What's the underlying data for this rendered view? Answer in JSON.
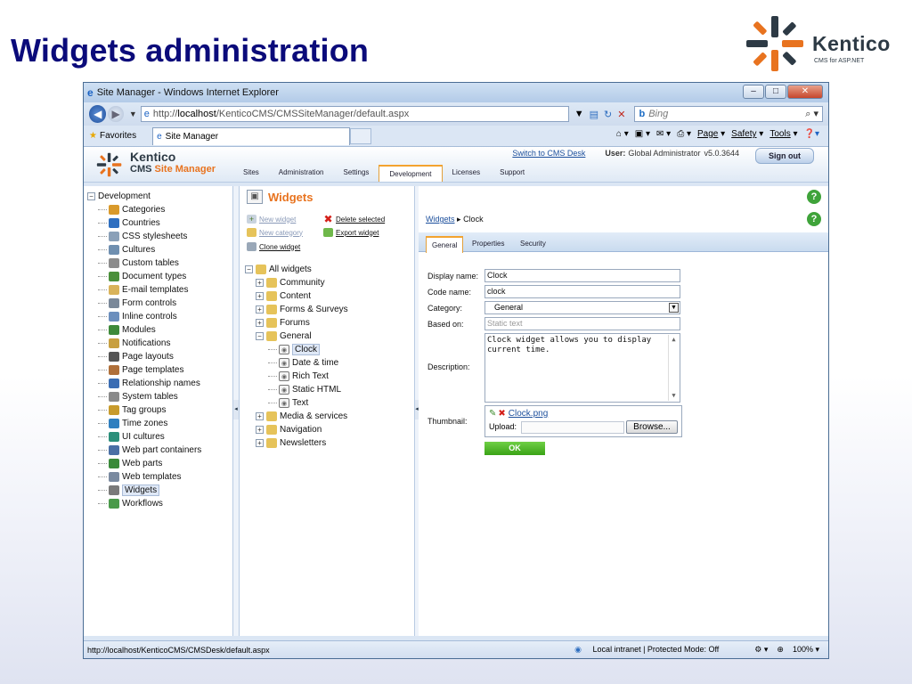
{
  "slide": {
    "title": "Widgets administration"
  },
  "brand": {
    "name": "Kentico",
    "subtitle": "CMS for ASP.NET"
  },
  "browser": {
    "window_title": "Site Manager - Windows Internet Explorer",
    "address_prefix": "http://",
    "address_host": "localhost",
    "address_path": "/KenticoCMS/CMSSiteManager/default.aspx",
    "search_placeholder": "Bing",
    "favorites_label": "Favorites",
    "tab_label": "Site Manager",
    "cmd_page": "Page",
    "cmd_safety": "Safety",
    "cmd_tools": "Tools",
    "status_url": "http://localhost/KenticoCMS/CMSDesk/default.aspx",
    "status_zone": "Local intranet | Protected Mode: Off",
    "zoom": "100%"
  },
  "cms": {
    "logo_name": "Kentico",
    "logo_sub_a": "CMS",
    "logo_sub_b": "Site Manager",
    "switch_link": "Switch to CMS Desk",
    "user_label": "User:",
    "user_name": "Global Administrator",
    "version": "v5.0.3644",
    "sign_out": "Sign out",
    "tabs": [
      "Sites",
      "Administration",
      "Settings",
      "Development",
      "Licenses",
      "Support"
    ]
  },
  "left_tree": {
    "root": "Development",
    "items": [
      "Categories",
      "Countries",
      "CSS stylesheets",
      "Cultures",
      "Custom tables",
      "Document types",
      "E-mail templates",
      "Form controls",
      "Inline controls",
      "Modules",
      "Notifications",
      "Page layouts",
      "Page templates",
      "Relationship names",
      "System tables",
      "Tag groups",
      "Time zones",
      "UI cultures",
      "Web part containers",
      "Web parts",
      "Web templates",
      "Widgets",
      "Workflows"
    ],
    "colors": [
      "#d99a2b",
      "#2f6fc0",
      "#8aa0b8",
      "#6f8fb0",
      "#8c8c8c",
      "#4a8f3a",
      "#d9b35a",
      "#7a8899",
      "#6c8fbd",
      "#3e8a3a",
      "#c8a040",
      "#555555",
      "#b0703a",
      "#3b6db3",
      "#8a8a8a",
      "#c89b2c",
      "#2f7fbf",
      "#2b8f7a",
      "#4a6fa5",
      "#3a8a3a",
      "#7a8aa0",
      "#7a7a7a",
      "#4a9a4a"
    ]
  },
  "widgets_panel": {
    "title": "Widgets",
    "new_widget": "New widget",
    "delete_selected": "Delete selected",
    "new_category": "New category",
    "export_widget": "Export widget",
    "clone_widget": "Clone widget",
    "tree_root": "All widgets",
    "categories": [
      "Community",
      "Content",
      "Forms & Surveys",
      "Forums",
      "General"
    ],
    "general_children": [
      "Clock",
      "Date & time",
      "Rich Text",
      "Static HTML",
      "Text"
    ],
    "categories_after": [
      "Media & services",
      "Navigation",
      "Newsletters"
    ]
  },
  "detail": {
    "breadcrumb_root": "Widgets",
    "breadcrumb_current": "Clock",
    "tabs": [
      "General",
      "Properties",
      "Security"
    ],
    "labels": {
      "display_name": "Display name:",
      "code_name": "Code name:",
      "category": "Category:",
      "based_on": "Based on:",
      "description": "Description:",
      "thumbnail": "Thumbnail:"
    },
    "display_name": "Clock",
    "code_name": "clock",
    "category": "General",
    "based_on": "Static text",
    "description": "Clock widget allows you to display current time.",
    "thumbnail_file": "Clock.png",
    "upload_label": "Upload:",
    "browse": "Browse...",
    "ok": "OK"
  }
}
